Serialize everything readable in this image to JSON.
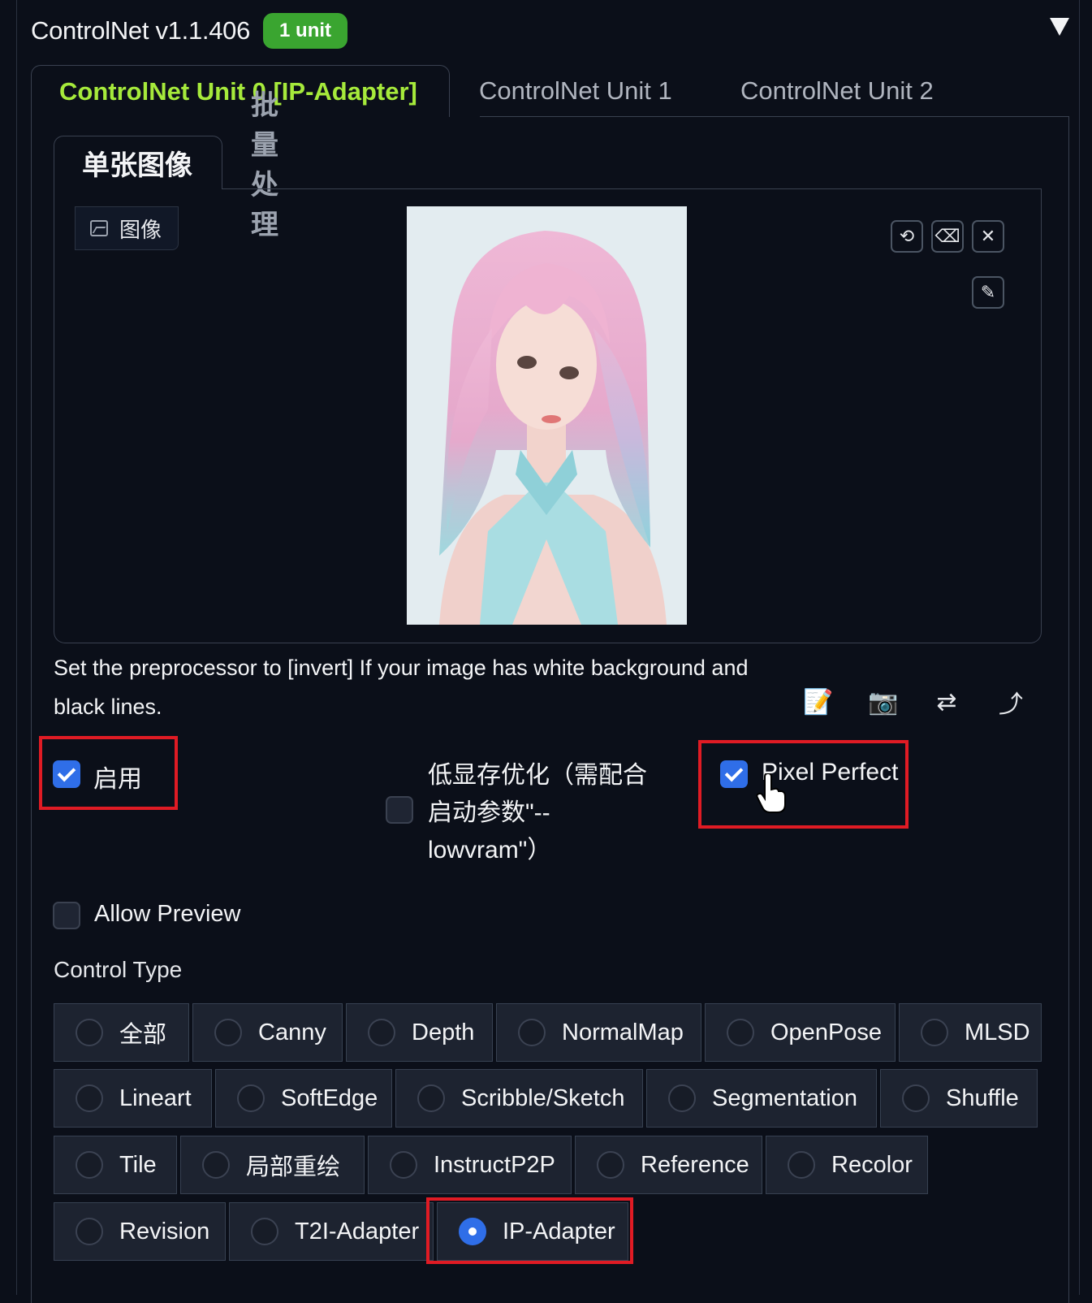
{
  "header": {
    "title": "ControlNet v1.1.406",
    "badge": "1 unit"
  },
  "unit_tabs": [
    {
      "label": "ControlNet Unit 0 [IP-Adapter]",
      "active": true
    },
    {
      "label": "ControlNet Unit 1",
      "active": false
    },
    {
      "label": "ControlNet Unit 2",
      "active": false
    }
  ],
  "mode_tabs": [
    {
      "label": "单张图像",
      "active": true
    },
    {
      "label": "批量处理",
      "active": false
    }
  ],
  "image_panel": {
    "label": "图像",
    "tools": [
      "undo-icon",
      "eraser-icon",
      "close-icon",
      "brush-icon"
    ]
  },
  "hint": "Set the preprocessor to [invert] If your image has white background and black lines.",
  "action_icons": [
    "edit-icon",
    "camera-icon",
    "swap-icon",
    "send-dimensions-icon"
  ],
  "options": {
    "enable": {
      "label": "启用",
      "checked": true
    },
    "lowvram": {
      "label_lines": [
        "低显存优化（需配合",
        "启动参数\"--",
        "lowvram\"）"
      ],
      "checked": false
    },
    "pixel_perfect": {
      "label": "Pixel Perfect",
      "checked": true
    },
    "allow_preview": {
      "label": "Allow Preview",
      "checked": false
    }
  },
  "control_type": {
    "label": "Control Type",
    "rows": [
      [
        "全部",
        "Canny",
        "Depth",
        "NormalMap",
        "OpenPose",
        "MLSD"
      ],
      [
        "Lineart",
        "SoftEdge",
        "Scribble/Sketch",
        "Segmentation",
        "Shuffle"
      ],
      [
        "Tile",
        "局部重绘",
        "InstructP2P",
        "Reference",
        "Recolor"
      ],
      [
        "Revision",
        "T2I-Adapter",
        "IP-Adapter"
      ]
    ],
    "selected": "IP-Adapter"
  },
  "colors": {
    "accent_tab": "#a6ea3b",
    "badge": "#3aa530",
    "check": "#2f6ee8",
    "highlight": "#e01b24"
  }
}
